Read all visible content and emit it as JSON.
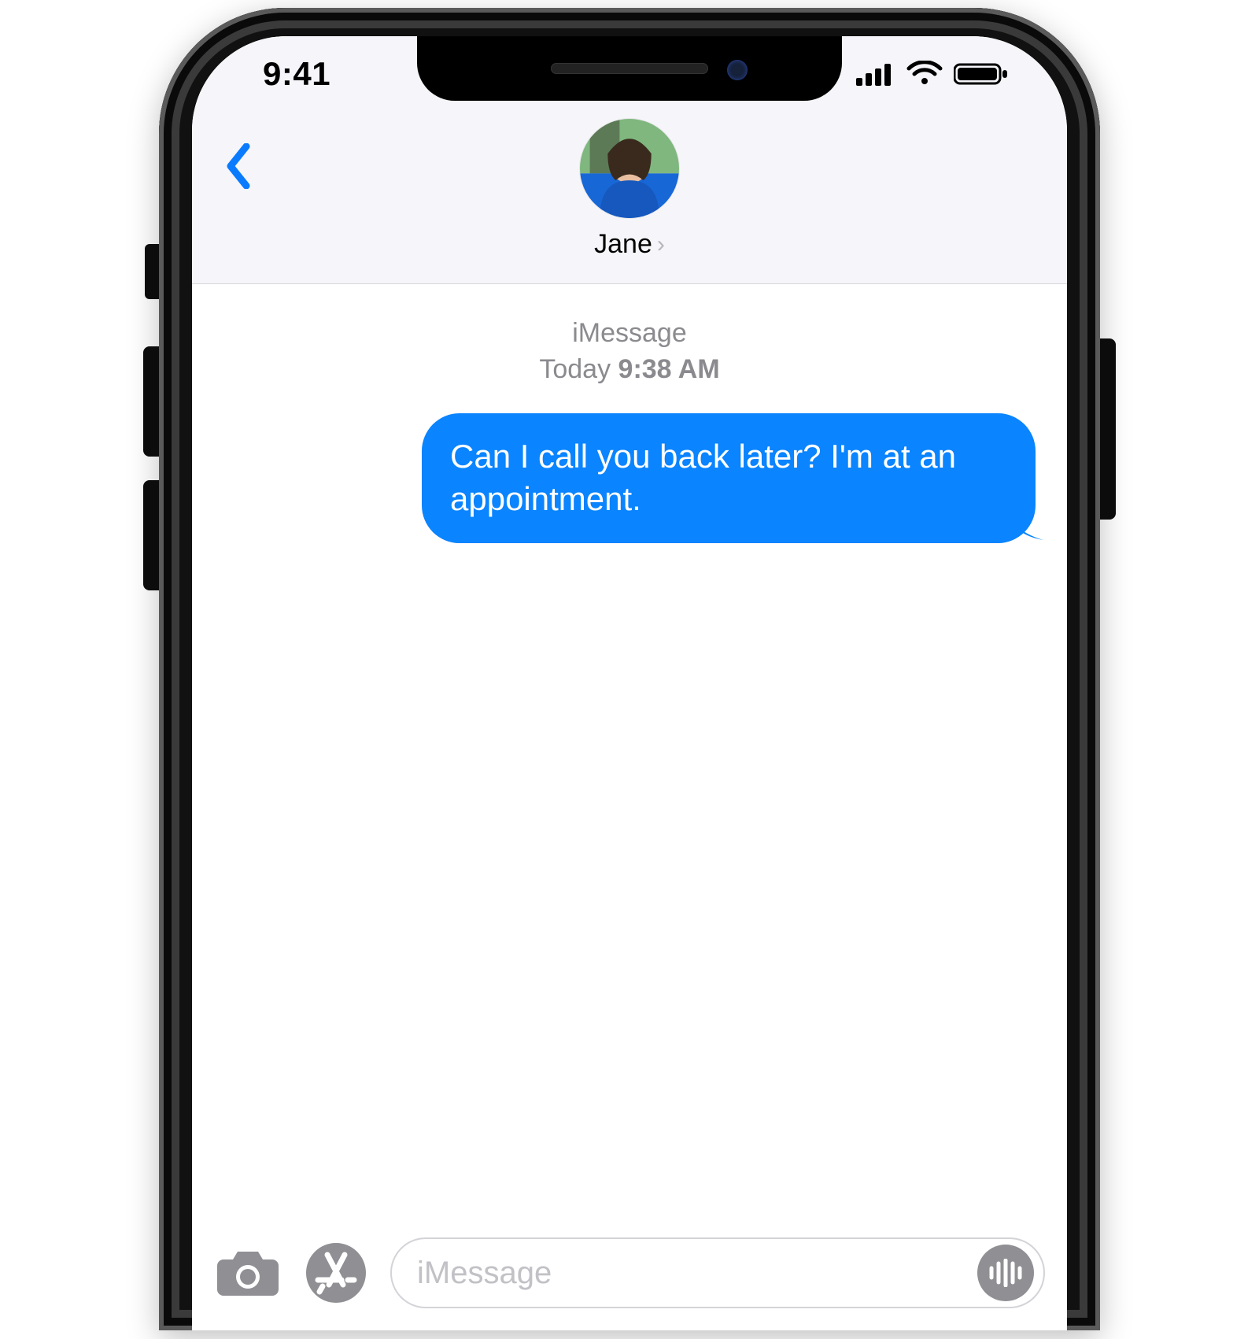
{
  "status": {
    "time": "9:41",
    "icons": {
      "cellular": "cellular-icon",
      "wifi": "wifi-icon",
      "battery": "battery-icon"
    }
  },
  "header": {
    "back_icon": "chevron-left-icon",
    "contact_name": "Jane",
    "contact_chevron": "›",
    "avatar_icon": "contact-avatar"
  },
  "thread": {
    "service_label": "iMessage",
    "day_label": "Today ",
    "time_label": "9:38 AM",
    "messages": [
      {
        "from": "me",
        "text": "Can I call you back later? I'm at an appointment."
      }
    ]
  },
  "compose": {
    "camera_icon": "camera-icon",
    "appstore_icon": "app-store-icon",
    "placeholder": "iMessage",
    "voice_icon": "audio-waveform-icon"
  },
  "colors": {
    "accent_blue": "#0a84ff",
    "header_bg": "#f6f5f9",
    "icon_gray": "#8f8f94"
  }
}
